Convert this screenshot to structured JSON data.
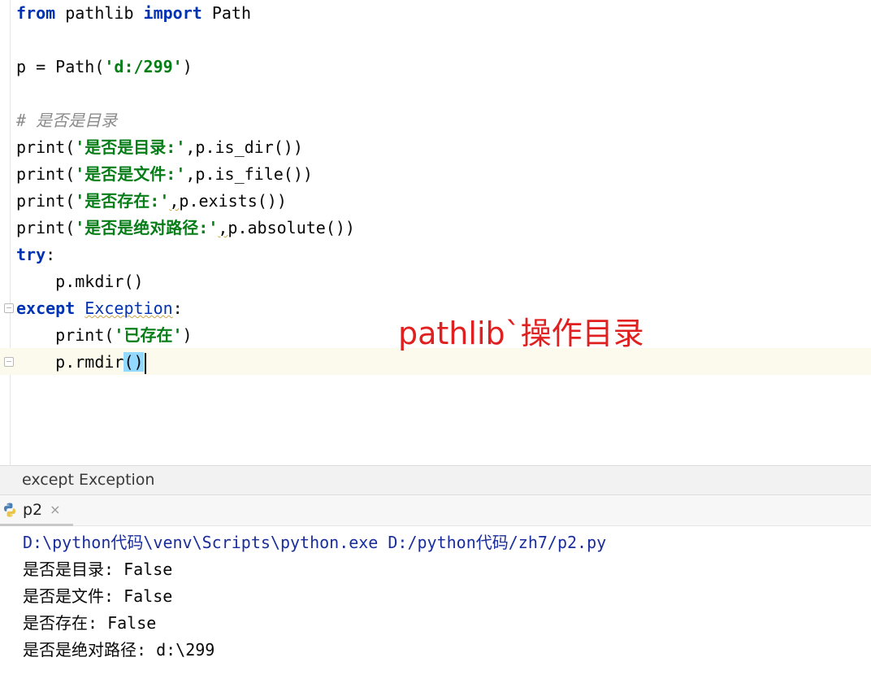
{
  "editor": {
    "line1": {
      "kw_from": "from",
      "module": " pathlib ",
      "kw_import": "import",
      "name": " Path"
    },
    "line2": {
      "pre": "p = Path(",
      "str": "'d:/299'",
      "post": ")"
    },
    "line3": {
      "comment": "# 是否是目录"
    },
    "line4": {
      "pre": "print(",
      "str": "'是否是目录:'",
      "post": ",p.is_dir())"
    },
    "line5": {
      "pre": "print(",
      "str": "'是否是文件:'",
      "post": ",p.is_file())"
    },
    "line6": {
      "pre": "print(",
      "str": "'是否存在:'",
      "comma": ",",
      "post": "p.exists())"
    },
    "line7": {
      "pre": "print(",
      "str": "'是否是绝对路径:'",
      "comma": ",",
      "post": "p.absolute())"
    },
    "line8": {
      "kw": "try",
      "post": ":"
    },
    "line9": {
      "indent": "    ",
      "code": "p.mkdir()"
    },
    "line10": {
      "kw": "except",
      "space": " ",
      "cls": "Exception",
      "post": ":"
    },
    "line11": {
      "indent": "    ",
      "pre": "print(",
      "str": "'已存在'",
      "post": ")"
    },
    "line12": {
      "indent": "    ",
      "pre": "p.rmdir",
      "paren": "()"
    }
  },
  "annotation": "pathlib`操作目录",
  "breadcrumb": "except Exception",
  "run": {
    "tab_label": "p2",
    "tab_close": "×",
    "tab_icon": "python-icon",
    "console": [
      "D:\\python代码\\venv\\Scripts\\python.exe D:/python代码/zh7/p2.py",
      "是否是目录: False",
      "是否是文件: False",
      "是否存在: False",
      "是否是绝对路径: d:\\299"
    ]
  },
  "colors": {
    "keyword": "#0033b3",
    "string": "#067d17",
    "comment": "#8c8c8c",
    "annotation": "#e02020",
    "console_command": "#1a2d9c",
    "current_line": "#fcfaed",
    "paren_highlight": "#93d9ff"
  }
}
